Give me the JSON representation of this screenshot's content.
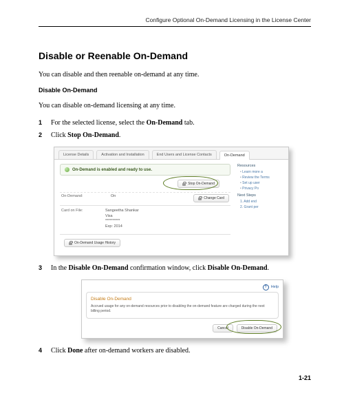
{
  "header": {
    "running": "Configure Optional On-Demand Licensing in the License Center"
  },
  "section": {
    "title": "Disable or Reenable On-Demand",
    "intro": "You can disable and then reenable on-demand at any time.",
    "sub": "Disable On-Demand",
    "sub_intro": "You can disable on-demand licensing at any time."
  },
  "steps": {
    "s1": {
      "n": "1",
      "pre": "For the selected license, select the ",
      "bold": "On-Demand",
      "post": " tab."
    },
    "s2": {
      "n": "2",
      "pre": "Click ",
      "bold": "Stop On-Demand",
      "post": "."
    },
    "s3": {
      "n": "3",
      "pre": "In the ",
      "bold1": "Disable On-Demand",
      "mid": " confirmation window, click ",
      "bold2": "Disable On-Demand",
      "post": "."
    },
    "s4": {
      "n": "4",
      "pre": "Click ",
      "bold": "Done",
      "post": " after on-demand workers are disabled."
    }
  },
  "fig1": {
    "tabs": {
      "details": "License Details",
      "activation": "Activation and Installation",
      "endusers": "End Users and License Contacts",
      "ondemand": "On-Demand"
    },
    "status": "On-Demand is enabled and ready to use.",
    "stop_btn": "Stop On-Demand",
    "row1": {
      "k": "On-Demand:",
      "v": "On"
    },
    "change_card": "Change Card",
    "card": {
      "k": "Card on File:",
      "name": "Sangeetha Shankar",
      "brand": "Visa",
      "mask": "**********",
      "exp": "Exp: 2014"
    },
    "usage_btn": "On-Demand Usage History",
    "resources": {
      "h": "Resources",
      "items": {
        "a": "Learn more a",
        "b": "Review the Terms",
        "c": "Set up user",
        "d": "Privacy Po"
      }
    },
    "next": {
      "h": "Next Steps",
      "items": {
        "a": "1. Add end",
        "b": "2. Grant per"
      }
    }
  },
  "fig2": {
    "help": "Help",
    "title": "Disable On-Demand",
    "body": "Accrued usage for any on-demand resources prior to disabling the on-demand feature are charged during the next billing period.",
    "cancel": "Cancel",
    "confirm": "Disable On-Demand"
  },
  "pagenum": "1-21"
}
